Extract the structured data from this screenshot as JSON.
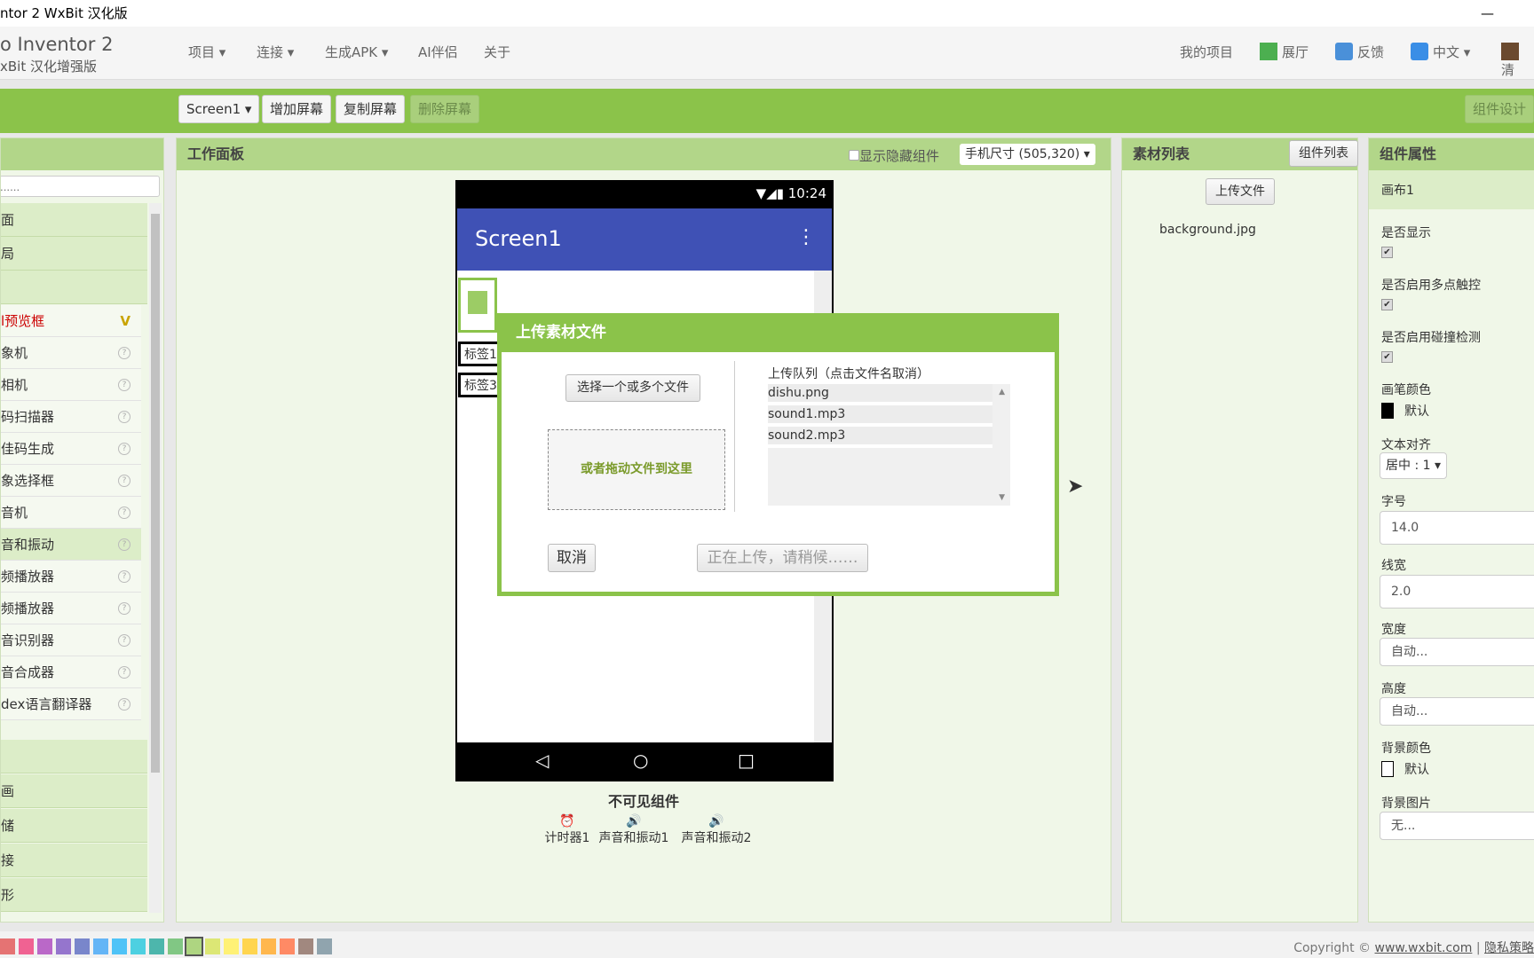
{
  "window": {
    "title": "ntor 2 WxBit 汉化版",
    "minimize_icon": "minimize-icon"
  },
  "header": {
    "logo_line1": "o Inventor 2",
    "logo_line2": "xBit 汉化增强版",
    "menus": [
      {
        "label": "项目 ▾"
      },
      {
        "label": "连接 ▾"
      },
      {
        "label": "生成APK ▾"
      },
      {
        "label": "AI伴侣"
      },
      {
        "label": "关于"
      }
    ],
    "right": {
      "my_projects": "我的项目",
      "gallery": "展厅",
      "feedback": "反馈",
      "language": "中文 ▾",
      "user": "清"
    }
  },
  "toolbar": {
    "screen_select": "Screen1 ▾",
    "add_screen": "增加屏幕",
    "copy_screen": "复制屏幕",
    "delete_screen": "删除屏幕",
    "designer": "组件设计"
  },
  "palette": {
    "search_placeholder": "......",
    "headers_top": [
      "面",
      "局",
      ""
    ],
    "items": [
      {
        "label": "l预览框",
        "badge": "V"
      },
      {
        "label": "象机"
      },
      {
        "label": "相机"
      },
      {
        "label": "码扫描器"
      },
      {
        "label": "佳码生成"
      },
      {
        "label": "象选择框"
      },
      {
        "label": "音机"
      },
      {
        "label": "音和振动"
      },
      {
        "label": "频播放器"
      },
      {
        "label": "频播放器"
      },
      {
        "label": "音识别器"
      },
      {
        "label": "音合成器"
      },
      {
        "label": "dex语言翻译器"
      }
    ],
    "headers_bottom": [
      "",
      "画",
      "储",
      "接",
      "形"
    ]
  },
  "viewer": {
    "title": "工作面板",
    "show_hidden": "显示隐藏组件",
    "size_select": "手机尺寸 (505,320) ▾",
    "phone": {
      "time": "10:24",
      "screen_title": "Screen1",
      "label1": "标签1",
      "label3": "标签3"
    },
    "nonvisible_title": "不可见组件",
    "nonvisible": [
      {
        "label": "计时器1",
        "icon": "clock-icon"
      },
      {
        "label": "声音和振动1",
        "icon": "speaker-icon"
      },
      {
        "label": "声音和振动2",
        "icon": "speaker-icon"
      }
    ]
  },
  "dialog": {
    "title": "上传素材文件",
    "choose_files": "选择一个或多个文件",
    "drop_zone": "或者拖动文件到这里",
    "queue_label": "上传队列（点击文件名取消）",
    "queue": [
      "dishu.png",
      "sound1.mp3",
      "sound2.mp3"
    ],
    "cancel": "取消",
    "uploading": "正在上传，请稍候……"
  },
  "assets": {
    "title": "素材列表",
    "components_list": "组件列表",
    "upload": "上传文件",
    "files": [
      "background.jpg"
    ]
  },
  "properties": {
    "title": "组件属性",
    "component": "画布1",
    "visible": "是否显示",
    "multitouch": "是否启用多点触控",
    "collision": "是否启用碰撞检测",
    "paint_color": "画笔颜色",
    "paint_color_value": "默认",
    "text_align": "文本对齐",
    "text_align_value": "居中 : 1 ▾",
    "font_size": "字号",
    "font_size_value": "14.0",
    "line_width": "线宽",
    "line_width_value": "2.0",
    "width": "宽度",
    "width_value": "自动...",
    "height": "高度",
    "height_value": "自动...",
    "bg_color": "背景颜色",
    "bg_color_value": "默认",
    "bg_image": "背景图片",
    "bg_image_value": "无..."
  },
  "footer": {
    "copyright": "Copyright © ",
    "link": "www.wxbit.com",
    "sep": " | ",
    "privacy": "隐私策略",
    "swatches": [
      "#e57373",
      "#f06292",
      "#ba68c8",
      "#9575cd",
      "#7986cb",
      "#64b5f6",
      "#4fc3f7",
      "#4dd0e1",
      "#4db6ac",
      "#81c784",
      "#aed581",
      "#dce775",
      "#fff176",
      "#ffd54f",
      "#ffb74d",
      "#ff8a65",
      "#a1887f",
      "#90a4ae"
    ]
  },
  "colors": {
    "accent": "#8bc34a",
    "panel_head": "#b2d689",
    "phone_bar": "#3f51b5"
  }
}
